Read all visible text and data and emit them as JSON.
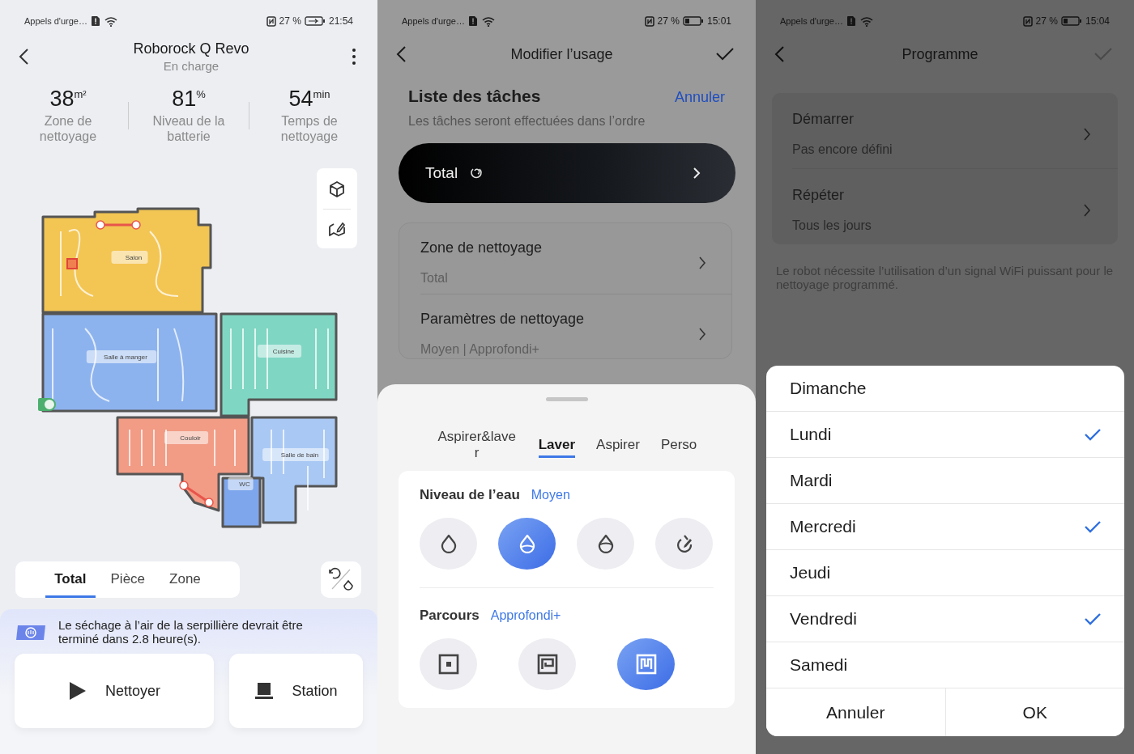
{
  "device_screen": {
    "status_bar": {
      "notice": "Appels d'urge…",
      "battery": "27 %",
      "time": "21:54",
      "charging": true
    },
    "header": {
      "title": "Roborock Q Revo",
      "subtitle": "En charge"
    },
    "stats": [
      {
        "value": "38",
        "unit": "m²",
        "label": "Zone de nettoyage"
      },
      {
        "value": "81",
        "unit": "%",
        "label": "Niveau de la batterie"
      },
      {
        "value": "54",
        "unit": "min",
        "label": "Temps de nettoyage"
      }
    ],
    "map": {
      "rooms": [
        {
          "name": "Salon",
          "color": "#f3c553"
        },
        {
          "name": "Salle à manger",
          "color": "#8db3ee"
        },
        {
          "name": "Cuisine",
          "color": "#7fd6c3"
        },
        {
          "name": "Couloir",
          "color": "#f29b85"
        },
        {
          "name": "Salle de bain",
          "color": "#a9c8f4"
        },
        {
          "name": "WC",
          "color": "#7ea6ec"
        }
      ]
    },
    "mode_tabs": [
      {
        "label": "Total",
        "selected": true
      },
      {
        "label": "Pièce",
        "selected": false
      },
      {
        "label": "Zone",
        "selected": false
      }
    ],
    "notice": "Le séchage à l’air de la serpillière devrait être terminé dans 2.8 heure(s).",
    "actions": [
      {
        "label": "Nettoyer",
        "kind": "play"
      },
      {
        "label": "Station",
        "kind": "dock"
      }
    ]
  },
  "usage_screen": {
    "status_bar": {
      "notice": "Appels d'urge…",
      "battery": "27 %",
      "time": "15:01",
      "charging": false
    },
    "header": {
      "title": "Modifier l’usage"
    },
    "task_list": {
      "title": "Liste des tâches",
      "cancel": "Annuler",
      "subtitle": "Les tâches seront effectuées dans l’ordre"
    },
    "task": {
      "label": "Total"
    },
    "settings": [
      {
        "title": "Zone de nettoyage",
        "value": "Total"
      },
      {
        "title": "Paramètres de nettoyage",
        "value": "Moyen | Approfondi+"
      }
    ],
    "sheet": {
      "tabs": [
        {
          "label": "Aspirer&laver",
          "selected": false
        },
        {
          "label": "Laver",
          "selected": true
        },
        {
          "label": "Aspirer",
          "selected": false
        },
        {
          "label": "Perso",
          "selected": false
        }
      ],
      "water": {
        "title": "Niveau de l’eau",
        "value": "Moyen",
        "options": [
          {
            "kind": "low",
            "selected": false
          },
          {
            "kind": "medium",
            "selected": true
          },
          {
            "kind": "high",
            "selected": false
          },
          {
            "kind": "custom",
            "selected": false
          }
        ]
      },
      "route": {
        "title": "Parcours",
        "value": "Approfondi+",
        "options": [
          {
            "kind": "standard",
            "selected": false
          },
          {
            "kind": "deep",
            "selected": false
          },
          {
            "kind": "deep_plus",
            "selected": true
          }
        ]
      }
    }
  },
  "schedule_screen": {
    "status_bar": {
      "notice": "Appels d'urge…",
      "battery": "27 %",
      "time": "15:04",
      "charging": false
    },
    "header": {
      "title": "Programme"
    },
    "settings": [
      {
        "title": "Démarrer",
        "value": "Pas encore défini"
      },
      {
        "title": "Répéter",
        "value": "Tous les jours"
      }
    ],
    "note": "Le robot nécessite l’utilisation d’un signal WiFi puissant pour le nettoyage programmé.",
    "day_picker": {
      "days": [
        {
          "label": "Dimanche",
          "checked": false
        },
        {
          "label": "Lundi",
          "checked": true
        },
        {
          "label": "Mardi",
          "checked": false
        },
        {
          "label": "Mercredi",
          "checked": true
        },
        {
          "label": "Jeudi",
          "checked": false
        },
        {
          "label": "Vendredi",
          "checked": true
        },
        {
          "label": "Samedi",
          "checked": false
        }
      ],
      "buttons": [
        "Annuler",
        "OK"
      ]
    }
  }
}
